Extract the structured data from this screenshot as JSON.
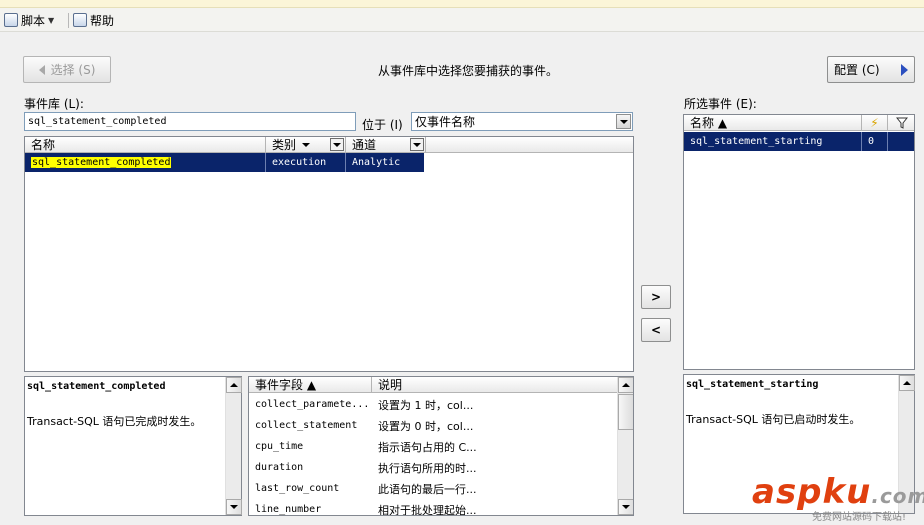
{
  "toolbar": {
    "script_label": "脚本",
    "help_label": "帮助"
  },
  "nav": {
    "back_label": "选择 (S)",
    "instruction": "从事件库中选择您要捕获的事件。",
    "next_label": "配置 (C)"
  },
  "library": {
    "label": "事件库 (L):",
    "search_value": "sql_statement_completed",
    "search_in_label": "位于 (I)",
    "search_in_value": "仅事件名称",
    "columns": [
      "名称",
      "类别",
      "通道"
    ],
    "rows": [
      {
        "name": "sql_statement_completed",
        "category": "execution",
        "channel": "Analytic"
      }
    ]
  },
  "selected": {
    "label": "所选事件 (E):",
    "columns": [
      "名称 ▲"
    ],
    "rows": [
      {
        "name": "sql_statement_starting",
        "count": "0"
      }
    ]
  },
  "move_buttons": {
    "add": ">",
    "remove": "<"
  },
  "desc_left": {
    "title": "sql_statement_completed",
    "text": "Transact-SQL 语句已完成时发生。"
  },
  "fields": {
    "columns": [
      "事件字段 ▲",
      "说明"
    ],
    "rows": [
      {
        "field": "collect_paramete...",
        "desc": "设置为 1 时，col..."
      },
      {
        "field": "collect_statement",
        "desc": "设置为 0 时，col..."
      },
      {
        "field": "cpu_time",
        "desc": "指示语句占用的 C..."
      },
      {
        "field": "duration",
        "desc": "执行语句所用的时..."
      },
      {
        "field": "last_row_count",
        "desc": "此语句的最后一行..."
      },
      {
        "field": "line_number",
        "desc": "相对于批处理起始..."
      }
    ]
  },
  "desc_right": {
    "title": "sql_statement_starting",
    "text": "Transact-SQL 语句已启动时发生。"
  },
  "watermark": {
    "brand": "aspku",
    "dot": ".com",
    "sub": "免费网站源码下载站!"
  },
  "colors": {
    "selection": "#0a246a",
    "highlight": "#ffff00",
    "watermark": "#e0400f"
  }
}
